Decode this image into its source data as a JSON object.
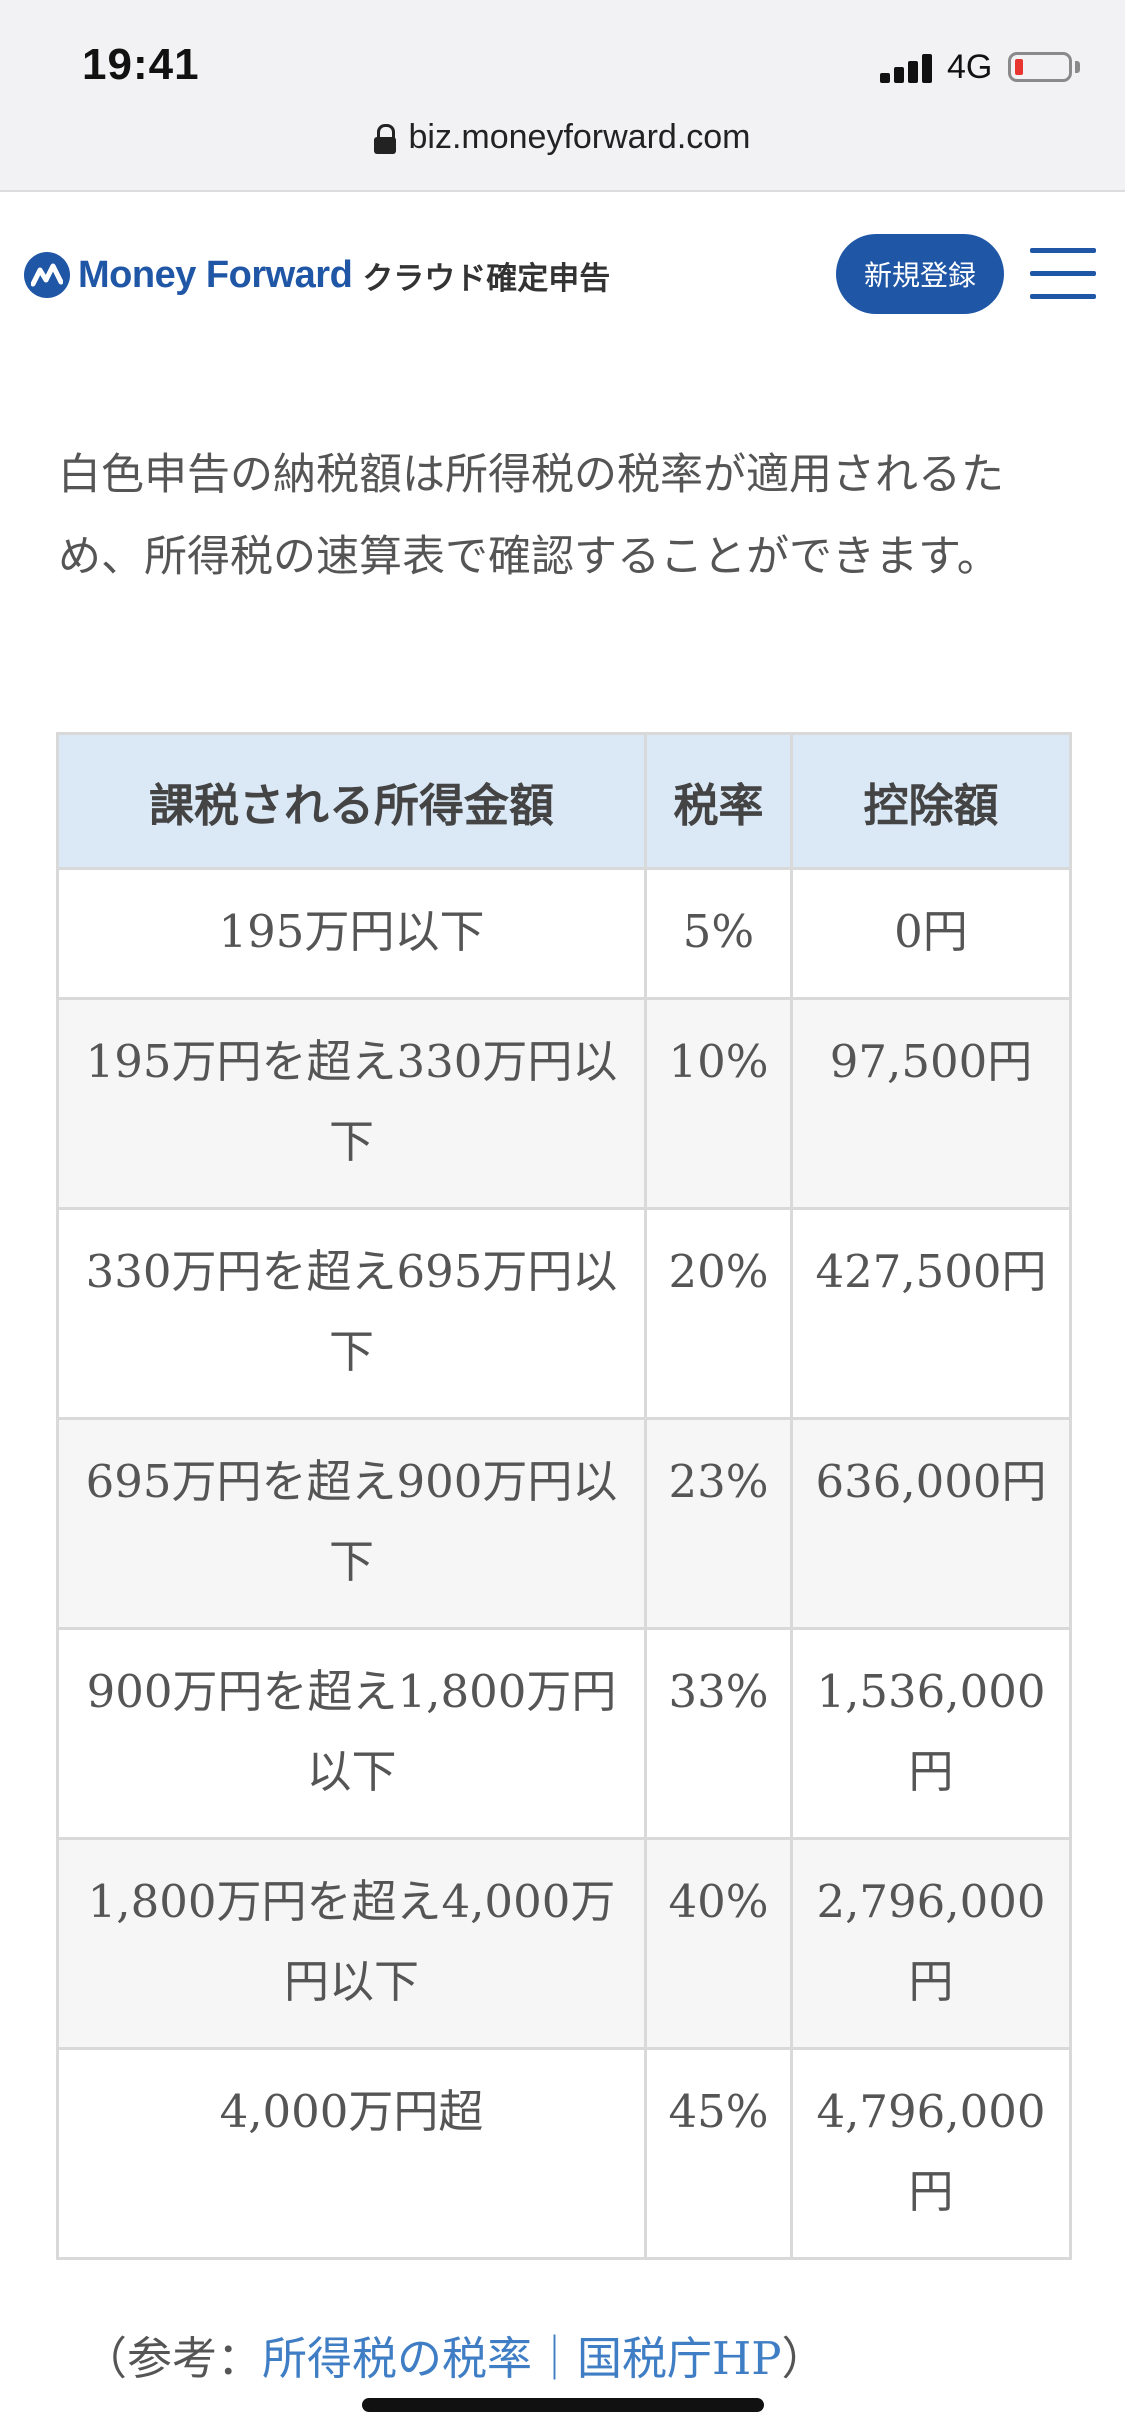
{
  "status_bar": {
    "time": "19:41",
    "network": "4G",
    "battery_level": 0.1
  },
  "browser": {
    "url": "biz.moneyforward.com"
  },
  "header": {
    "logo_text": "Money Forward",
    "logo_sub": "クラウド確定申告",
    "signup_label": "新規登録",
    "brand_color": "#1f56a6"
  },
  "intro": "白色申告の納税額は所得税の税率が適用されるため、所得税の速算表で確認することができます。",
  "table": {
    "headers": [
      "課税される所得金額",
      "税率",
      "控除額"
    ],
    "rows": [
      {
        "income": "195万円以下",
        "rate": "5%",
        "deduction": "0円"
      },
      {
        "income": "195万円を超え330万円以下",
        "rate": "10%",
        "deduction": "97,500円"
      },
      {
        "income": "330万円を超え695万円以下",
        "rate": "20%",
        "deduction": "427,500円"
      },
      {
        "income": "695万円を超え900万円以下",
        "rate": "23%",
        "deduction": "636,000円"
      },
      {
        "income": "900万円を超え1,800万円以下",
        "rate": "33%",
        "deduction": "1,536,000円"
      },
      {
        "income": "1,800万円を超え4,000万円以下",
        "rate": "40%",
        "deduction": "2,796,000円"
      },
      {
        "income": "4,000万円超",
        "rate": "45%",
        "deduction": "4,796,000円"
      }
    ]
  },
  "reference": {
    "prefix": "（参考：",
    "link_text": "所得税の税率｜国税庁HP",
    "suffix": "）"
  }
}
